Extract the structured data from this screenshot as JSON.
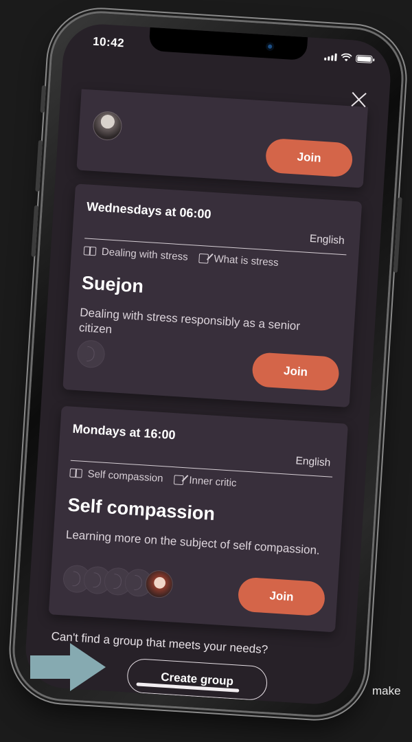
{
  "status": {
    "time": "10:42"
  },
  "cards": [
    {
      "join_label": "Join"
    },
    {
      "schedule": "Wednesdays at 06:00",
      "language": "English",
      "tags": [
        "Dealing with stress",
        "What is stress"
      ],
      "title": "Suejon",
      "description": "Dealing with stress responsibly as a senior citizen",
      "join_label": "Join"
    },
    {
      "schedule": "Mondays at 16:00",
      "language": "English",
      "tags": [
        "Self compassion",
        "Inner critic"
      ],
      "title": "Self compassion",
      "description": "Learning more on the subject of self compassion.",
      "join_label": "Join"
    }
  ],
  "footer": {
    "prompt": "Can't find a group that meets your needs?",
    "create_label": "Create group"
  },
  "outside_text": "make",
  "colors": {
    "accent": "#d46549",
    "card": "#382f3b",
    "screen": "#272128",
    "arrow": "#86aab1"
  },
  "icons": [
    "close-icon",
    "book-icon",
    "edit-icon",
    "signal-icon",
    "wifi-icon",
    "battery-icon",
    "arrow-icon"
  ]
}
